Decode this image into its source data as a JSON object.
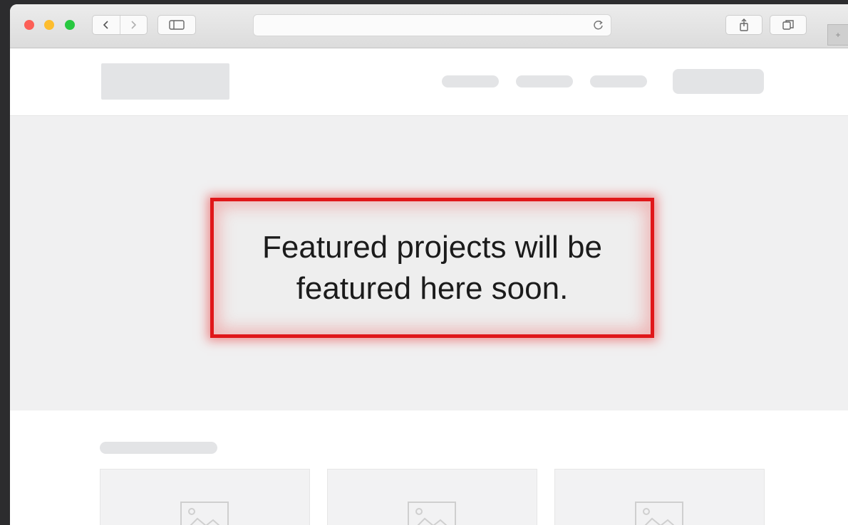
{
  "browser": {
    "toolbar_icons": {
      "close": "close-dot",
      "minimize": "minimize-dot",
      "maximize": "maximize-dot",
      "back": "chevron-left-icon",
      "forward": "chevron-right-icon",
      "sidebar": "sidebar-icon",
      "reload": "reload-icon",
      "share": "share-icon",
      "tabs": "tabs-icon"
    },
    "address_value": ""
  },
  "hero": {
    "callout_text": "Featured projects will be featured here soon.",
    "highlight_color": "#e0171a"
  },
  "projects": {
    "cards": [
      {
        "icon": "image-placeholder-icon"
      },
      {
        "icon": "image-placeholder-icon"
      },
      {
        "icon": "image-placeholder-icon"
      }
    ]
  },
  "colors": {
    "placeholder": "#e3e4e6",
    "hero_background": "#f0f0f1"
  }
}
